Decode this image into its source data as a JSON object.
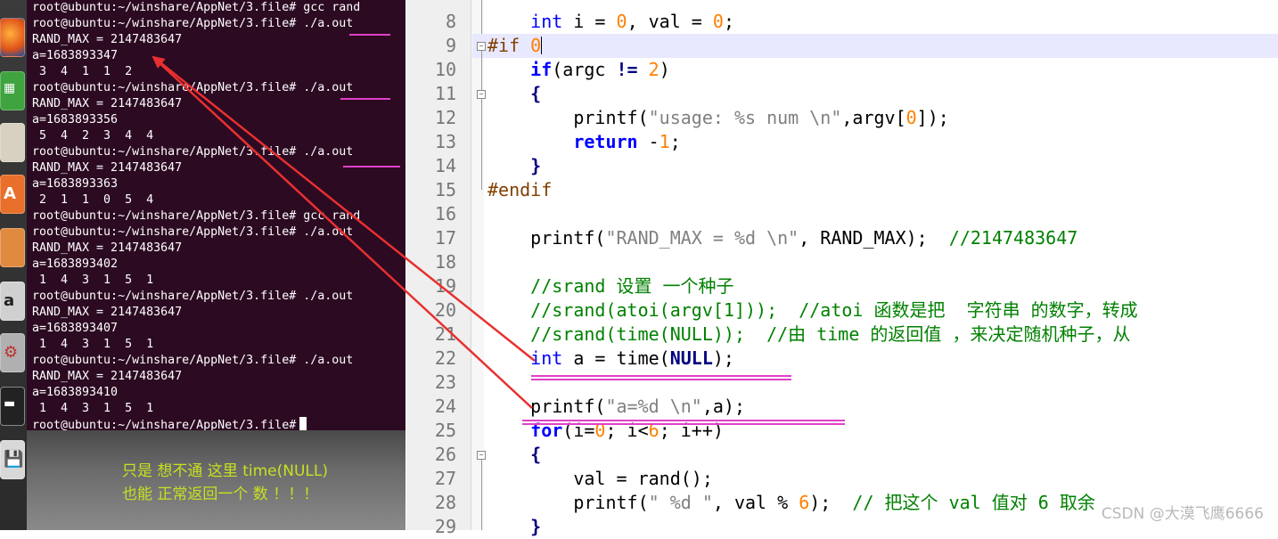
{
  "terminal": {
    "lines": [
      "root@ubuntu:~/winshare/AppNet/3.file# gcc rand",
      "root@ubuntu:~/winshare/AppNet/3.file# ./a.out",
      "RAND_MAX = 2147483647",
      "a=1683893347",
      " 3  4  1  1  2",
      "root@ubuntu:~/winshare/AppNet/3.file# ./a.out",
      "RAND_MAX = 2147483647",
      "a=1683893356",
      " 5  4  2  3  4  4",
      "root@ubuntu:~/winshare/AppNet/3.file# ./a.out",
      "RAND_MAX = 2147483647",
      "a=1683893363",
      " 2  1  1  0  5  4",
      "root@ubuntu:~/winshare/AppNet/3.file# gcc rand",
      "root@ubuntu:~/winshare/AppNet/3.file# ./a.out",
      "RAND_MAX = 2147483647",
      "a=1683893402",
      " 1  4  3  1  5  1",
      "root@ubuntu:~/winshare/AppNet/3.file# ./a.out",
      "RAND_MAX = 2147483647",
      "a=1683893407",
      " 1  4  3  1  5  1",
      "root@ubuntu:~/winshare/AppNet/3.file# ./a.out",
      "RAND_MAX = 2147483647",
      "a=1683893410",
      " 1  4  3  1  5  1",
      "root@ubuntu:~/winshare/AppNet/3.file#"
    ]
  },
  "note": {
    "line1": "只是 想不通 这里 time(NULL)",
    "line2": "也能 正常返回一个 数 ！！！"
  },
  "editor": {
    "line_numbers": [
      "8",
      "9",
      "10",
      "11",
      "12",
      "13",
      "14",
      "15",
      "16",
      "17",
      "18",
      "19",
      "20",
      "21",
      "22",
      "23",
      "24",
      "25",
      "26",
      "27",
      "28",
      "29"
    ],
    "tokens": {
      "l8_kw": "int",
      "l8_a": " i = ",
      "l8_n1": "0",
      "l8_b": ", val = ",
      "l8_n2": "0",
      "l8_c": ";",
      "l9_pp": "#if ",
      "l9_n": "0",
      "l10_kw": "if",
      "l10_a": "(argc ",
      "l10_op": "!=",
      "l10_sp": " ",
      "l10_n": "2",
      "l10_b": ")",
      "l11": "{",
      "l12_a": "printf(",
      "l12_s": "\"usage: %s num \\n\"",
      "l12_b": ",argv[",
      "l12_n": "0",
      "l12_c": "]);",
      "l13_kw": "return",
      "l13_a": " -",
      "l13_n": "1",
      "l13_b": ";",
      "l14": "}",
      "l15_pp": "#endif",
      "l17_a": "printf(",
      "l17_s": "\"RAND_MAX = %d \\n\"",
      "l17_b": ", RAND_MAX);  ",
      "l17_cm": "//2147483647",
      "l19_cm": "//srand 设置 一个种子",
      "l20_cm": "//srand(atoi(argv[1]));  //atoi 函数是把  字符串 的数字，转成",
      "l21_cm": "//srand(time(NULL));  //由 time 的返回值 ，来决定随机种子，从",
      "l22_kw": "int",
      "l22_a": " a = time(",
      "l22_null": "NULL",
      "l22_b": ");",
      "l24_a": "printf(",
      "l24_s": "\"a=%d \\n\"",
      "l24_b": ",a);",
      "l25_kw": "for",
      "l25_a": "(i=",
      "l25_n1": "0",
      "l25_b": "; i<",
      "l25_n2": "6",
      "l25_c": "; i++)",
      "l26": "{",
      "l27_a": "val = rand();",
      "l28_a": "printf(",
      "l28_s": "\" %d \"",
      "l28_b": ", val % ",
      "l28_n": "6",
      "l28_c": ");  ",
      "l28_cm": "// 把这个 val 值对 6 取余",
      "l29": "}"
    }
  },
  "watermark": "CSDN @大漠飞鹰6666",
  "colors": {
    "terminal_bg": "#2c0a22",
    "annotation_red": "#e83030",
    "annotation_pink": "#e040c8",
    "note_green": "#c8e020",
    "line_highlight": "#e8e8ff"
  }
}
